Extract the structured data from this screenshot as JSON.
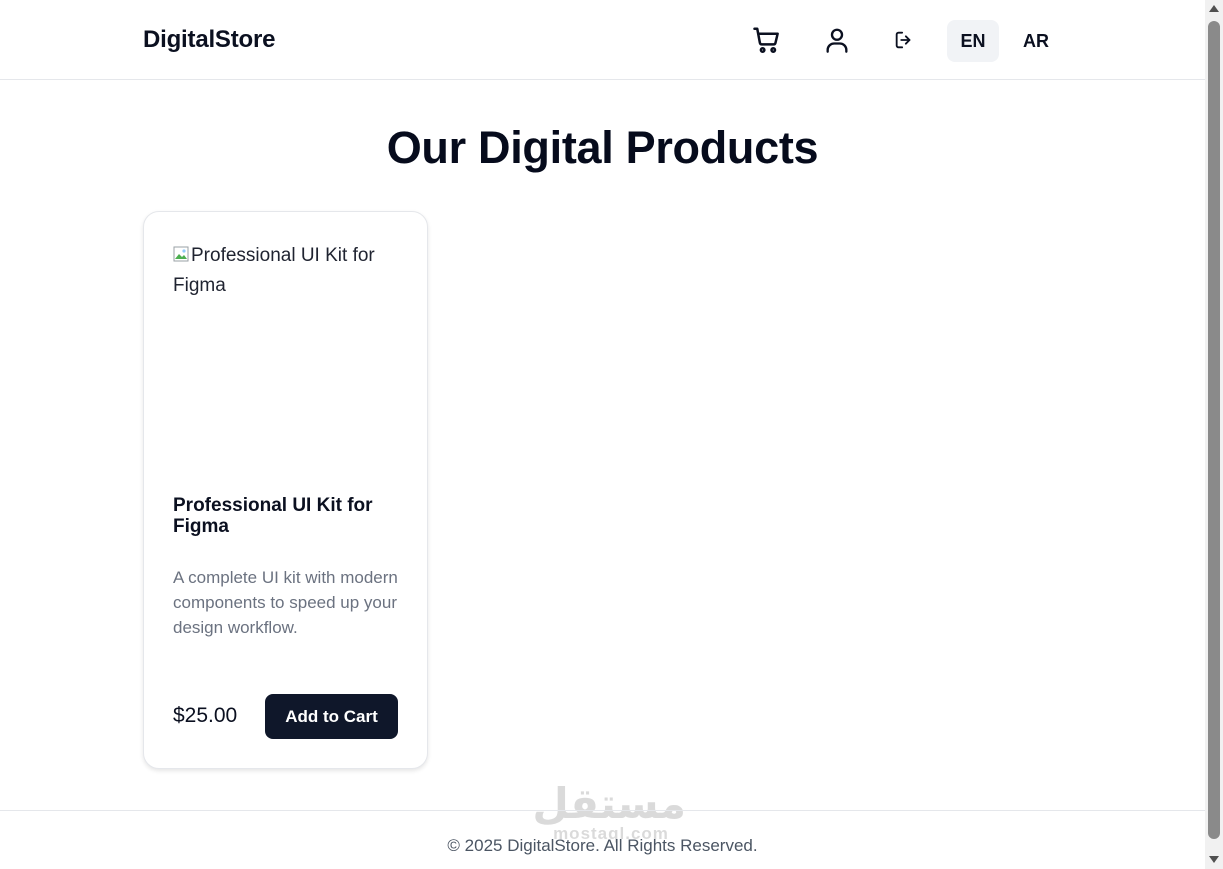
{
  "header": {
    "brand": "DigitalStore",
    "icons": {
      "cart": "shopping-cart-icon",
      "user": "user-icon",
      "logout": "logout-icon"
    },
    "languages": [
      {
        "label": "EN",
        "active": true
      },
      {
        "label": "AR",
        "active": false
      }
    ]
  },
  "main": {
    "title": "Our Digital Products",
    "products": [
      {
        "image_alt": "Professional UI Kit for Figma",
        "name": "Professional UI Kit for Figma",
        "description": "A complete UI kit with modern components to speed up your design workflow.",
        "price": "$25.00",
        "button_label": "Add to Cart"
      }
    ]
  },
  "footer": {
    "copyright": "© 2025 DigitalStore. All Rights Reserved."
  },
  "watermark": {
    "arabic": "مستقل",
    "latin": "mostaql.com"
  },
  "colors": {
    "primary_button": "#0f172a",
    "active_lang_bg": "#f1f3f6",
    "muted_text": "#6b7280",
    "border": "#e5e7eb"
  }
}
